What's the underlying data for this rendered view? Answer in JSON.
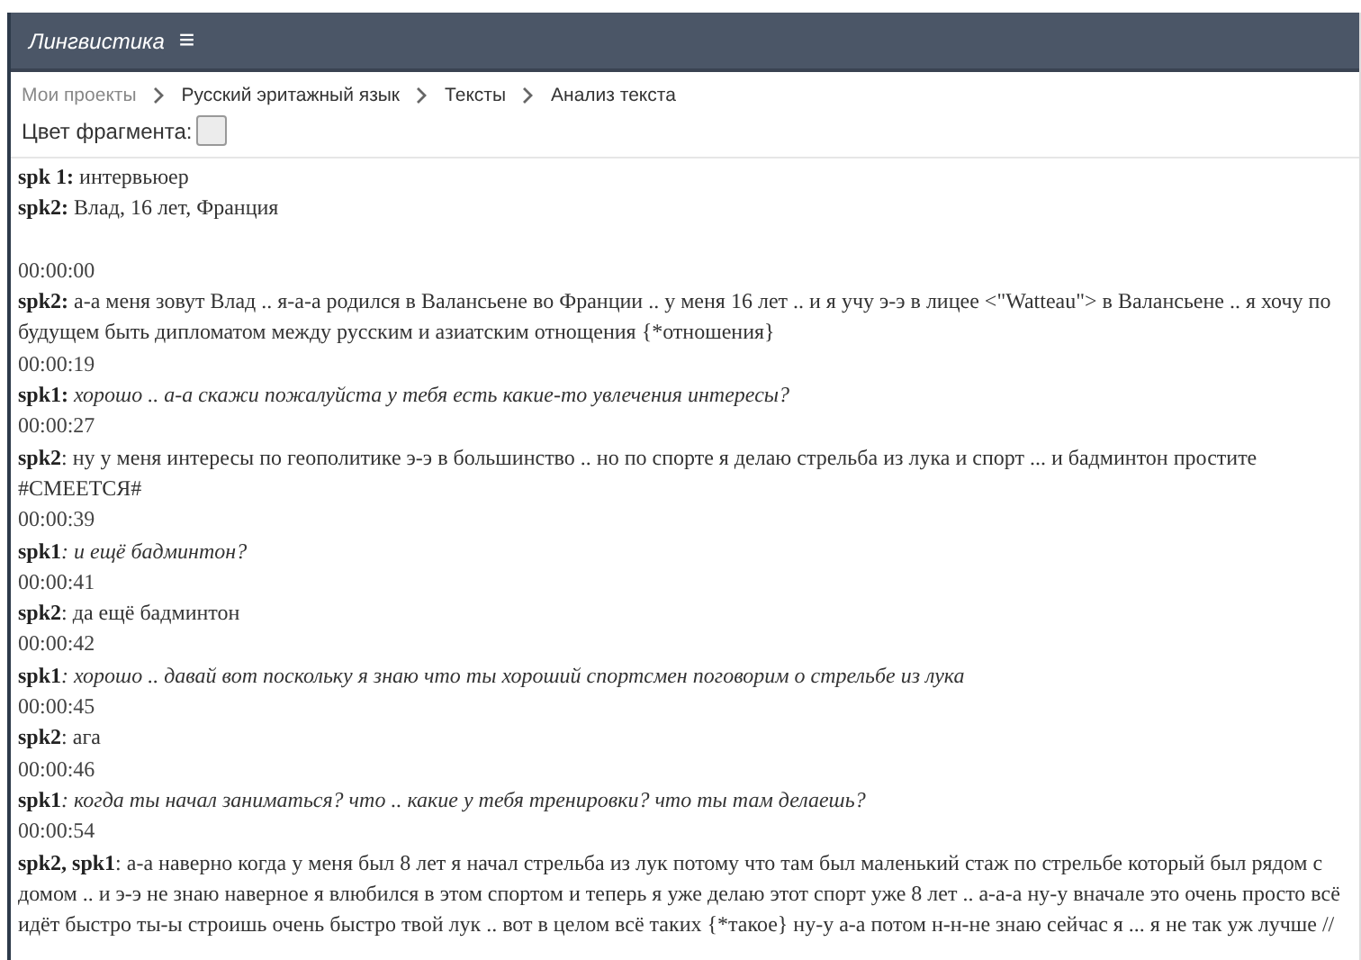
{
  "header": {
    "title": "Лингвистика",
    "menu_icon": "≡"
  },
  "breadcrumbs": [
    {
      "label": "Мои проекты",
      "current": false
    },
    {
      "label": "Русский эритажный язык",
      "current": true
    },
    {
      "label": "Тексты",
      "current": true
    },
    {
      "label": "Анализ текста",
      "current": true
    }
  ],
  "color_picker": {
    "label": "Цвет фрагмента:"
  },
  "transcript": [
    {
      "kind": "line",
      "speaker": "spk 1:",
      "text": " интервьюер",
      "italic": false
    },
    {
      "kind": "line",
      "speaker": "spk2:",
      "text": " Влад, 16 лет, Франция",
      "italic": false
    },
    {
      "kind": "blank"
    },
    {
      "kind": "time",
      "text": "00:00:00"
    },
    {
      "kind": "line",
      "speaker": "spk2:",
      "text": " а-а меня зовут Влад .. я-а-а родился в Валансьене во Франции .. у меня 16 лет .. и я учу э-э в лицее <\"Watteau\"> в Валансьене .. я хочу по будущем быть дипломатом между русским и азиатским отнощения {*отношения}",
      "italic": false
    },
    {
      "kind": "time",
      "text": "00:00:19"
    },
    {
      "kind": "line",
      "speaker": "spk1:",
      "text": " хорошо .. а-а скажи пожалуйста у тебя есть какие-то увлечения интересы?",
      "italic": true
    },
    {
      "kind": "time",
      "text": "00:00:27"
    },
    {
      "kind": "line",
      "speaker": "spk2",
      "text": ": ну у меня интересы по геополитике э-э в большинство .. но по спорте я делаю стрельба из лука и спорт ... и бадминтон простите #СМЕЕТСЯ#",
      "italic": false
    },
    {
      "kind": "time",
      "text": "00:00:39"
    },
    {
      "kind": "line",
      "speaker": "spk1",
      "text": ": и ещё бадминтон?",
      "italic": true
    },
    {
      "kind": "time",
      "text": "00:00:41"
    },
    {
      "kind": "line",
      "speaker": "spk2",
      "text": ": да ещё бадминтон",
      "italic": false
    },
    {
      "kind": "time",
      "text": "00:00:42"
    },
    {
      "kind": "line",
      "speaker": "spk1",
      "text": ": хорошо .. давай вот поскольку я знаю что ты хороший спортсмен поговорим о стрельбе из лука",
      "italic": true
    },
    {
      "kind": "time",
      "text": "00:00:45"
    },
    {
      "kind": "line",
      "speaker": "spk2",
      "text": ": ага",
      "italic": false
    },
    {
      "kind": "time",
      "text": "00:00:46"
    },
    {
      "kind": "line",
      "speaker": "spk1",
      "text": ": когда ты начал заниматься? что .. какие у тебя тренировки? что ты там делаешь?",
      "italic": true
    },
    {
      "kind": "time",
      "text": "00:00:54"
    },
    {
      "kind": "line",
      "speaker": "spk2, spk1",
      "text": ": а-а наверно когда у меня был 8 лет я начал стрельба из лук потому что там был маленький стаж по стрельбе который был рядом с домом .. и э-э не знаю наверное я влюбился в этом спортом и теперь я уже делаю этот спорт уже 8 лет .. а-а-а ну-у вначале это очень просто всё идёт быстро ты-ы строишь очень быстро твой лук .. вот в целом всё таких {*такое} ну-у а-а потом н-н-не знаю сейчас я ... я не так уж лучше //",
      "italic": false
    }
  ]
}
